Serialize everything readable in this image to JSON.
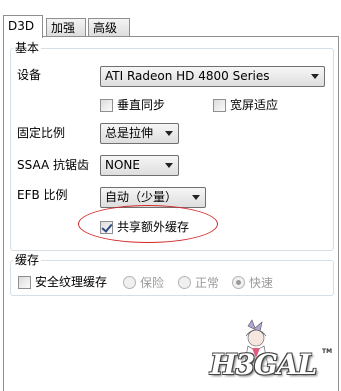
{
  "tabs": [
    {
      "label": "D3D",
      "active": true
    },
    {
      "label": "加强",
      "active": false
    },
    {
      "label": "高级",
      "active": false
    }
  ],
  "basic": {
    "title": "基本",
    "device_label": "设备",
    "device_value": "ATI Radeon HD 4800 Series",
    "vsync_label": "垂直同步",
    "vsync_checked": false,
    "widescreen_label": "宽屏适应",
    "widescreen_checked": false,
    "aspect_label": "固定比例",
    "aspect_value": "总是拉伸",
    "ssaa_label": "SSAA 抗锯齿",
    "ssaa_value": "NONE",
    "efb_label": "EFB 比例",
    "efb_value": "自动（少量）",
    "share_buffer_label": "共享额外缓存",
    "share_buffer_checked": true
  },
  "cache": {
    "title": "缓存",
    "safe_texture_label": "安全纹理缓存",
    "safe_texture_checked": false,
    "options": [
      {
        "label": "保险",
        "selected": false
      },
      {
        "label": "正常",
        "selected": false
      },
      {
        "label": "快速",
        "selected": true
      }
    ]
  },
  "watermark": {
    "text": "H3GAL",
    "tm": "TM"
  },
  "colors": {
    "annotation": "#d22a2a",
    "check": "#2c4a7e"
  }
}
